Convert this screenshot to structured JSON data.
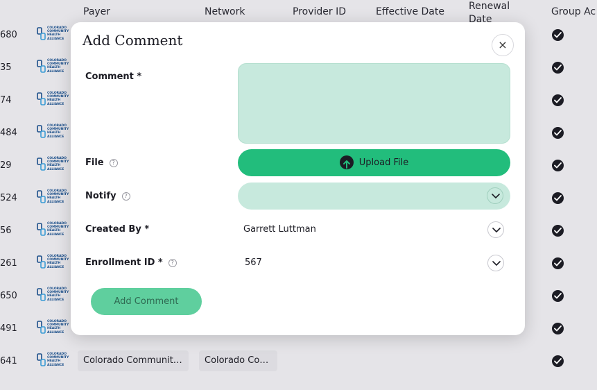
{
  "table": {
    "headers": {
      "payer": "Payer",
      "network": "Network",
      "provider_id": "Provider ID",
      "effective_date": "Effective Date",
      "renewal_date": "Renewal Date",
      "group_active": "Group Ac"
    },
    "row_numbers": [
      "680",
      "35",
      "74",
      "484",
      "29",
      "524",
      "56",
      "261",
      "650",
      "491",
      "641"
    ],
    "logo_text": "COLORADO COMMUNITY HEALTH ALLIANCE",
    "last_row": {
      "payer": "Colorado Communit…",
      "network": "Colorado Co…"
    }
  },
  "modal": {
    "title": "Add Comment",
    "close_icon": "×",
    "comment_label": "Comment *",
    "comment_value": "",
    "file_label": "File",
    "upload_label": "Upload File",
    "notify_label": "Notify",
    "created_by_label": "Created By *",
    "created_by_value": "Garrett Luttman",
    "enrollment_label": "Enrollment ID *",
    "enrollment_value": "567",
    "submit_label": "Add Comment",
    "help_icon": "?"
  },
  "colors": {
    "accent": "#22bd7c",
    "field_bg": "#c7e9dd",
    "submit_disabled": "#5fcf9e",
    "page_bg": "#e5e4e8"
  }
}
